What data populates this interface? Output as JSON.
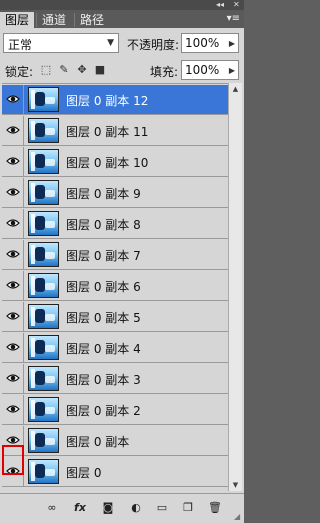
{
  "window": {
    "controls": [
      "◂◂",
      "✕"
    ]
  },
  "tabs": [
    {
      "label": "图层"
    },
    {
      "label": "通道"
    },
    {
      "label": "路径"
    }
  ],
  "tab_menu_icon": "panel-menu-icon",
  "blend": {
    "mode": "正常",
    "opacity_label": "不透明度:",
    "opacity_value": "100%"
  },
  "lock": {
    "label": "锁定:",
    "icons": [
      "lock-transparent-icon",
      "lock-brush-icon",
      "lock-move-icon",
      "lock-all-icon"
    ],
    "fill_label": "填充:",
    "fill_value": "100%"
  },
  "layers": [
    {
      "name": "图层 0 副本 12",
      "selected": true
    },
    {
      "name": "图层 0 副本 11"
    },
    {
      "name": "图层 0 副本 10"
    },
    {
      "name": "图层 0 副本 9"
    },
    {
      "name": "图层 0 副本 8"
    },
    {
      "name": "图层 0 副本 7"
    },
    {
      "name": "图层 0 副本 6"
    },
    {
      "name": "图层 0 副本 5"
    },
    {
      "name": "图层 0 副本 4"
    },
    {
      "name": "图层 0 副本 3"
    },
    {
      "name": "图层 0 副本 2"
    },
    {
      "name": "图层 0 副本"
    },
    {
      "name": "图层 0"
    }
  ],
  "bottom_icons": [
    "link-icon",
    "fx-icon",
    "mask-icon",
    "adjustment-icon",
    "folder-icon",
    "new-layer-icon",
    "trash-icon"
  ],
  "colors": {
    "selected": "#3a76d8",
    "highlight": "#e00000"
  }
}
